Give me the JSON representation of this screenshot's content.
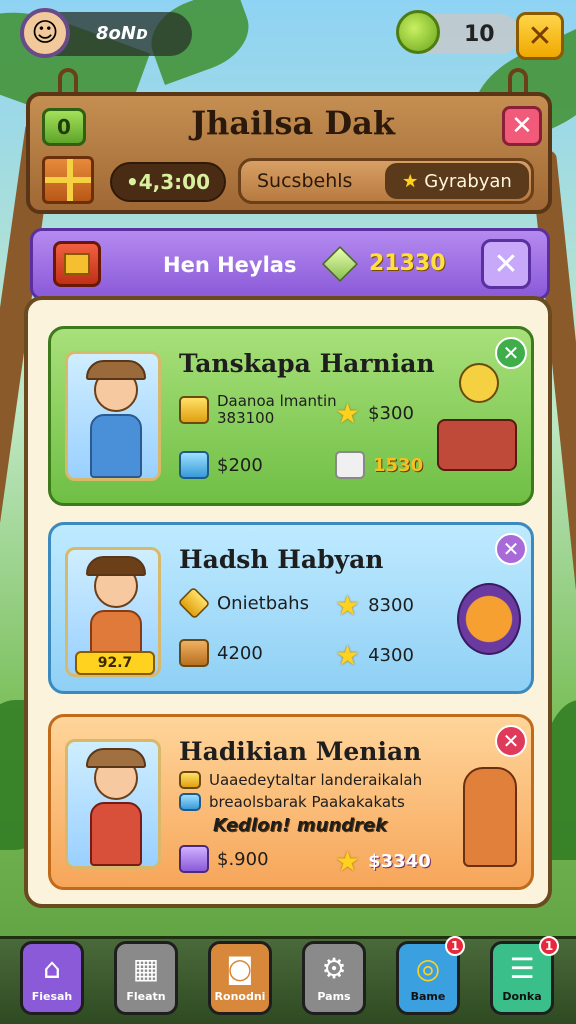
{
  "topbar": {
    "player_value": "8ᴏNᴅ",
    "coin_value": "10"
  },
  "header": {
    "level_badge": "0",
    "title": "Jhailsa Dak",
    "gem_value": "•4,3:00",
    "tab1_label": "Sucsbehls",
    "tab2_label": "Gyrabyan"
  },
  "banner": {
    "label": "Hen Heylas",
    "value": "21330"
  },
  "cards": [
    {
      "name": "Tanskapa Harnian",
      "line1a": "Daanoa lmantin",
      "line1b": "383100",
      "reward1": "$300",
      "price": "$200",
      "reward2": "1530",
      "accent": "#3fae4a"
    },
    {
      "name": "Hadsh Habyan",
      "line1": "Onietbahs",
      "reward1": "8300",
      "price": "4200",
      "reward2": "4300",
      "level": "92.7",
      "accent": "#a86ad8"
    },
    {
      "name": "Hadikian Menian",
      "desc1": "Uaaedeytaltar landeraikalah",
      "desc2": "breaolsbarak Paakakakats",
      "promo": "Kedlon! mundrek",
      "price": "$.900",
      "reward": "$3340",
      "accent": "#e03a5a"
    }
  ],
  "nav": [
    {
      "label": "Fiesah",
      "icon": "home-icon",
      "color": "#8a5ad8"
    },
    {
      "label": "Fleatn",
      "icon": "crate-icon",
      "color": "#8a8a8a"
    },
    {
      "label": "Ronodni",
      "icon": "bag-icon",
      "color": "#d8883a"
    },
    {
      "label": "Pams",
      "icon": "gear-icon",
      "color": "#8a8a8a"
    },
    {
      "label": "Bame",
      "icon": "ring-icon",
      "color": "#3aa0e0",
      "badge": "1"
    },
    {
      "label": "Donka",
      "icon": "notes-icon",
      "color": "#3abf8a",
      "badge": "1"
    }
  ]
}
